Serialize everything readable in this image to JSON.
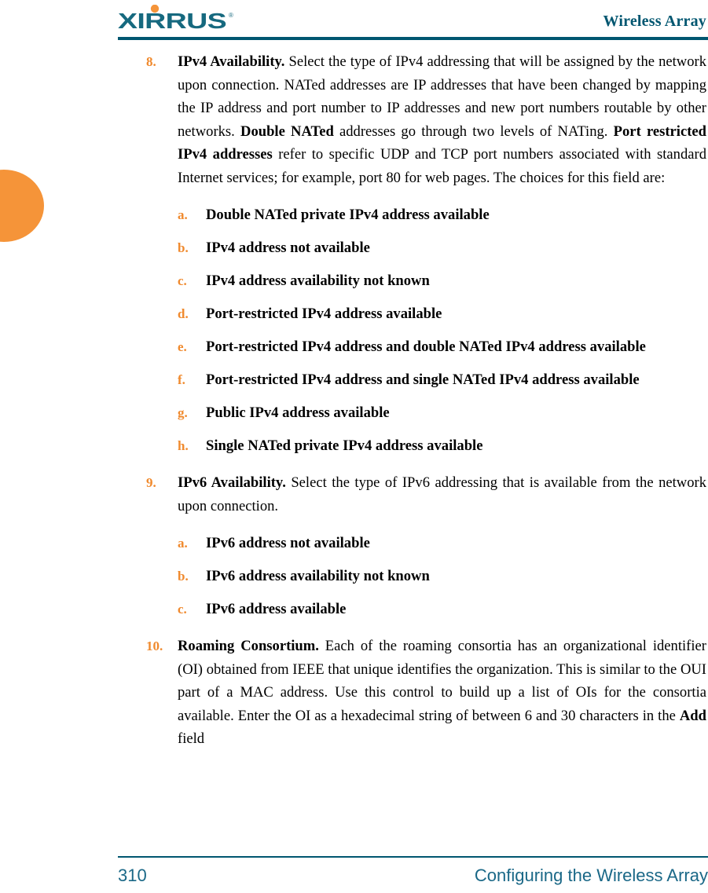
{
  "header": {
    "logo_text": "XIRRUS",
    "logo_trademark": "®",
    "title": "Wireless Array",
    "rule_color": "#005670"
  },
  "colors": {
    "teal": "#005670",
    "orange_marker": "#f08a2e",
    "orange_tab": "#f59439",
    "footer_text": "#1a6887"
  },
  "edge_tab": {
    "name": "chapter-thumb-tab",
    "color": "#f59439"
  },
  "content": {
    "items": [
      {
        "marker": "8.",
        "lead": "IPv4 Availability.",
        "text_1": " Select the type of IPv4 addressing that will be assigned by the network upon connection. NATed addresses are IP addresses that have been changed by mapping the IP address and port number to IP addresses and new port numbers routable by other networks. ",
        "bold_1": "Double NATed",
        "text_2": " addresses go through two levels of NATing. ",
        "bold_2": "Port restricted IPv4 addresses",
        "text_3": " refer to specific UDP and TCP port numbers associated with standard Internet services; for example, port 80 for web pages. The choices for this field are:",
        "subitems": [
          {
            "marker": "a.",
            "label": "Double NATed private IPv4 address available"
          },
          {
            "marker": "b.",
            "label": "IPv4 address not available"
          },
          {
            "marker": "c.",
            "label": "IPv4 address availability not known"
          },
          {
            "marker": "d.",
            "label": "Port-restricted IPv4 address available"
          },
          {
            "marker": "e.",
            "label": "Port-restricted IPv4 address and double NATed IPv4 address available"
          },
          {
            "marker": "f.",
            "label": "Port-restricted IPv4 address and single NATed IPv4 address available"
          },
          {
            "marker": "g.",
            "label": "Public IPv4 address available"
          },
          {
            "marker": "h.",
            "label": "Single NATed private IPv4 address available"
          }
        ]
      },
      {
        "marker": "9.",
        "lead": "IPv6 Availability.",
        "text_1": " Select the type of IPv6 addressing that is available from the network upon connection.",
        "subitems": [
          {
            "marker": "a.",
            "label": "IPv6 address not available"
          },
          {
            "marker": "b.",
            "label": "IPv6 address availability not known"
          },
          {
            "marker": "c.",
            "label": "IPv6 address available"
          }
        ]
      },
      {
        "marker": "10.",
        "lead": "Roaming Consortium.",
        "text_1": " Each of the roaming consortia has an organizational identifier (OI) obtained from IEEE that unique identifies the organization. This is similar to the OUI part of a MAC address. Use this control to build up a list of OIs for the consortia available. Enter the OI as a hexadecimal string of between 6 and 30 characters in the ",
        "bold_1": "Add",
        "text_2": " field"
      }
    ]
  },
  "footer": {
    "page_number": "310",
    "section_title": "Configuring the Wireless Array"
  }
}
